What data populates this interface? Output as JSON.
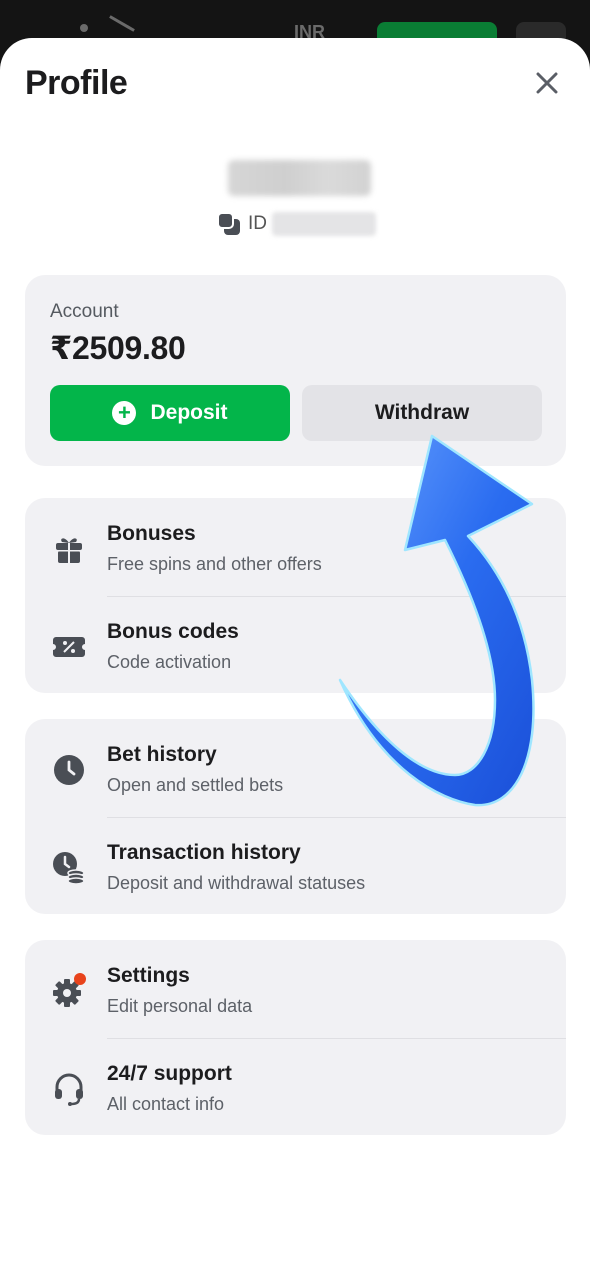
{
  "topbar": {
    "currency": "INR"
  },
  "profile": {
    "title": "Profile",
    "id_label": "ID"
  },
  "account": {
    "label": "Account",
    "balance": "₹2509.80",
    "deposit_label": "Deposit",
    "withdraw_label": "Withdraw"
  },
  "menu_groups": [
    {
      "items": [
        {
          "title": "Bonuses",
          "subtitle": "Free spins and other offers",
          "icon": "gift-icon"
        },
        {
          "title": "Bonus codes",
          "subtitle": "Code activation",
          "icon": "coupon-icon"
        }
      ]
    },
    {
      "items": [
        {
          "title": "Bet history",
          "subtitle": "Open and settled bets",
          "icon": "clock-icon"
        },
        {
          "title": "Transaction history",
          "subtitle": "Deposit and withdrawal statuses",
          "icon": "clock-coins-icon"
        }
      ]
    },
    {
      "items": [
        {
          "title": "Settings",
          "subtitle": "Edit personal data",
          "icon": "gear-icon"
        },
        {
          "title": "24/7 support",
          "subtitle": "All contact info",
          "icon": "headset-icon"
        }
      ]
    }
  ],
  "colors": {
    "deposit_green": "#03b54a",
    "card_bg": "#f1f1f4",
    "annotation_arrow": "#2f6ff0",
    "notification_dot": "#e8431c"
  }
}
